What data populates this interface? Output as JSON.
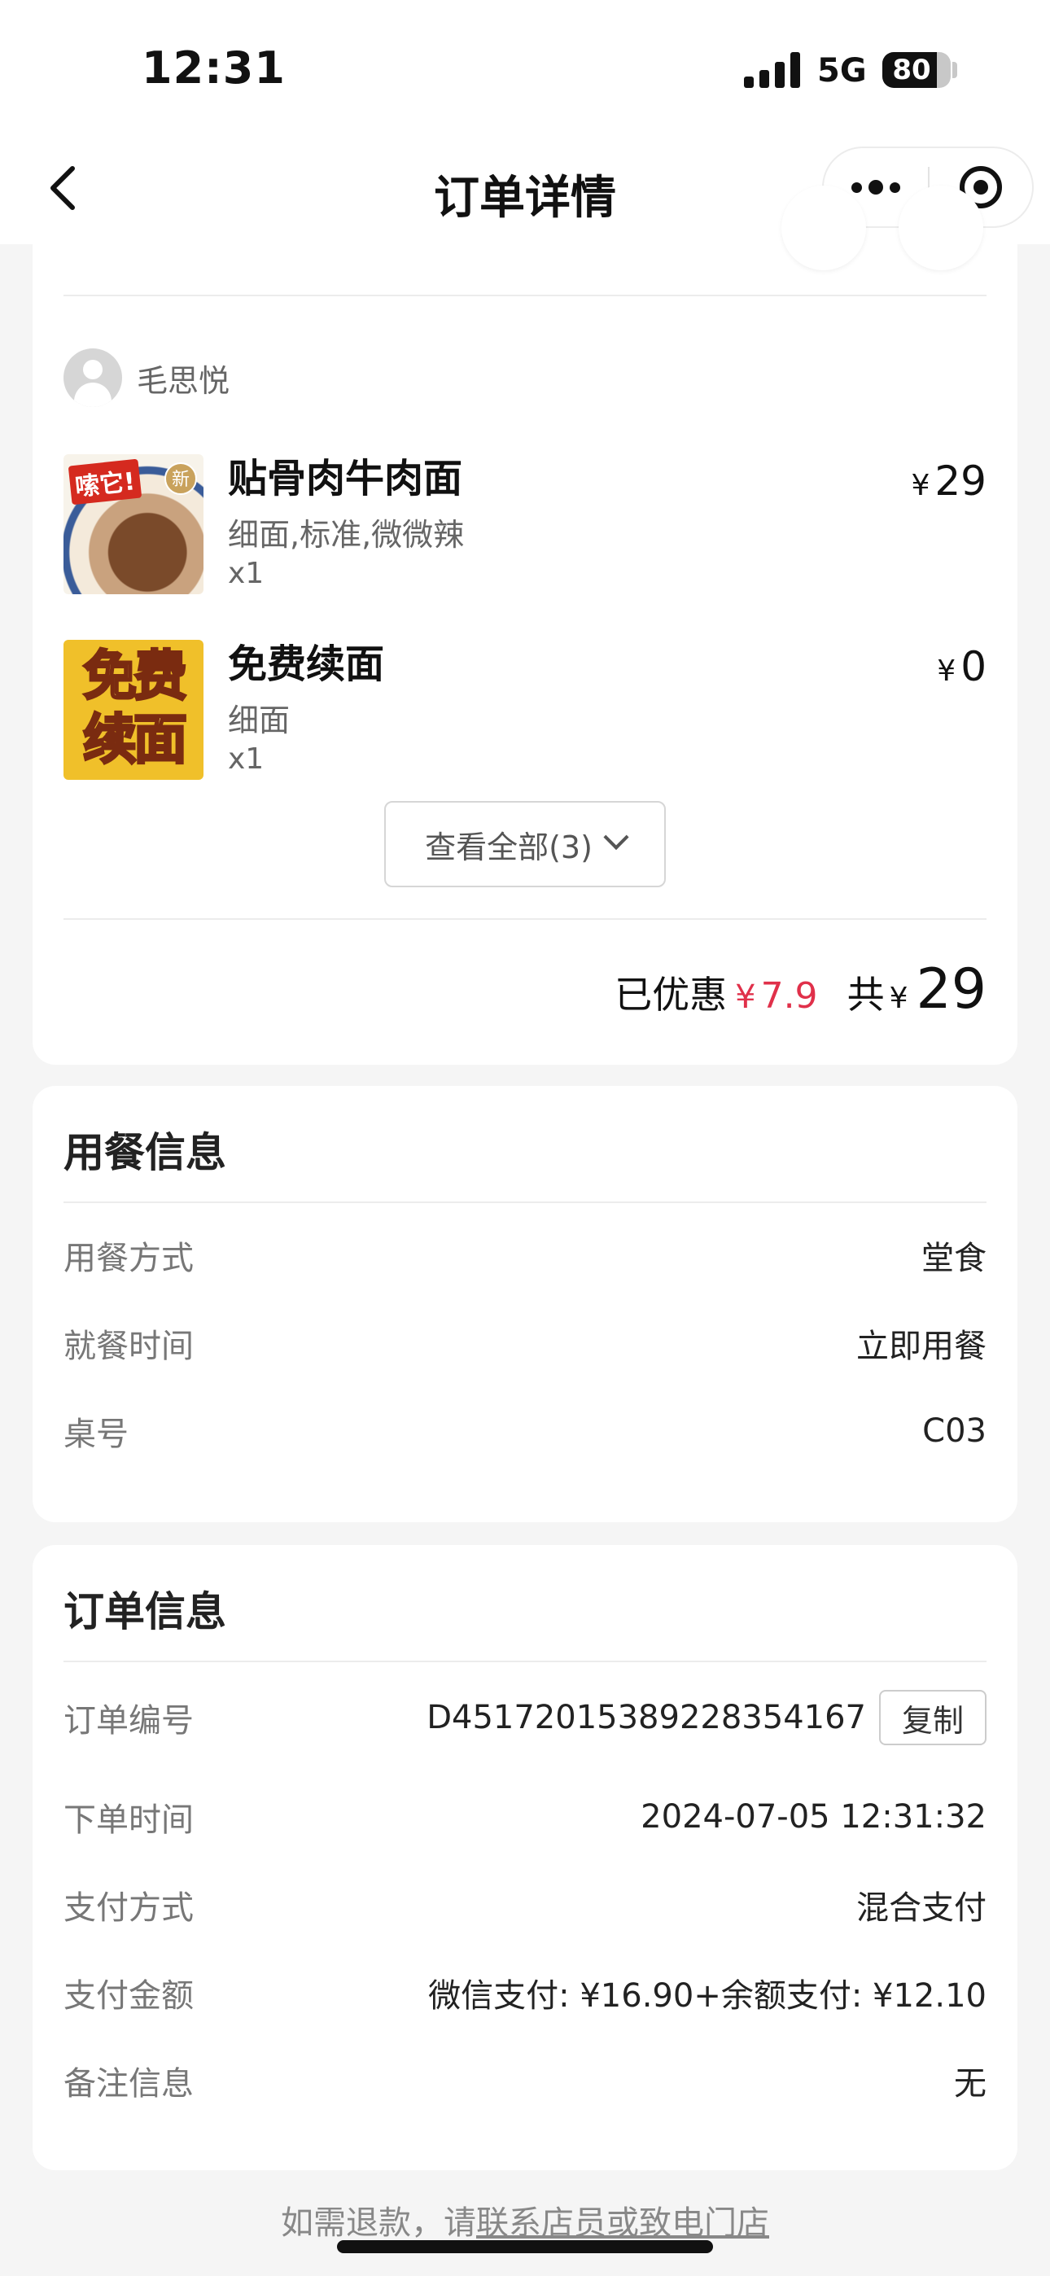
{
  "status_bar": {
    "time": "12:31",
    "network": "5G",
    "battery": "80",
    "battery_level": 0.8
  },
  "nav": {
    "title": "订单详情",
    "back_icon": "chevron-left-icon",
    "more_icon": "more-dots-icon",
    "close_icon": "target-icon"
  },
  "items_card": {
    "user_name": "毛思悦",
    "items": [
      {
        "name": "贴骨肉牛肉面",
        "spec": "细面,标准,微微辣",
        "qty": "x1",
        "currency": "¥",
        "price": "29",
        "thumb_badge": "嗦它!",
        "thumb_new": "新"
      },
      {
        "name": "免费续面",
        "spec": "细面",
        "qty": "x1",
        "currency": "¥",
        "price": "0",
        "thumb_text": "免费续面"
      }
    ],
    "view_all_label": "查看全部(3)",
    "discount_label": "已优惠",
    "discount_currency": "¥",
    "discount_value": "7.9",
    "total_label": "共",
    "total_currency": "¥",
    "total_value": "29"
  },
  "dining_card": {
    "title": "用餐信息",
    "rows": [
      {
        "key": "用餐方式",
        "value": "堂食"
      },
      {
        "key": "就餐时间",
        "value": "立即用餐"
      },
      {
        "key": "桌号",
        "value": "C03"
      }
    ]
  },
  "order_card": {
    "title": "订单信息",
    "order_no_label": "订单编号",
    "order_no": "D45172015389228354167",
    "copy_label": "复制",
    "rows": [
      {
        "key": "下单时间",
        "value": "2024-07-05 12:31:32"
      },
      {
        "key": "支付方式",
        "value": "混合支付"
      },
      {
        "key": "支付金额",
        "value": "微信支付: ¥16.90+余额支付: ¥12.10"
      },
      {
        "key": "备注信息",
        "value": "无"
      }
    ]
  },
  "footer": {
    "prefix": "如需退款，请",
    "link": "联系店员或致电门店"
  },
  "colors": {
    "accent_red": "#e0304a",
    "background": "#f5f5f5"
  }
}
